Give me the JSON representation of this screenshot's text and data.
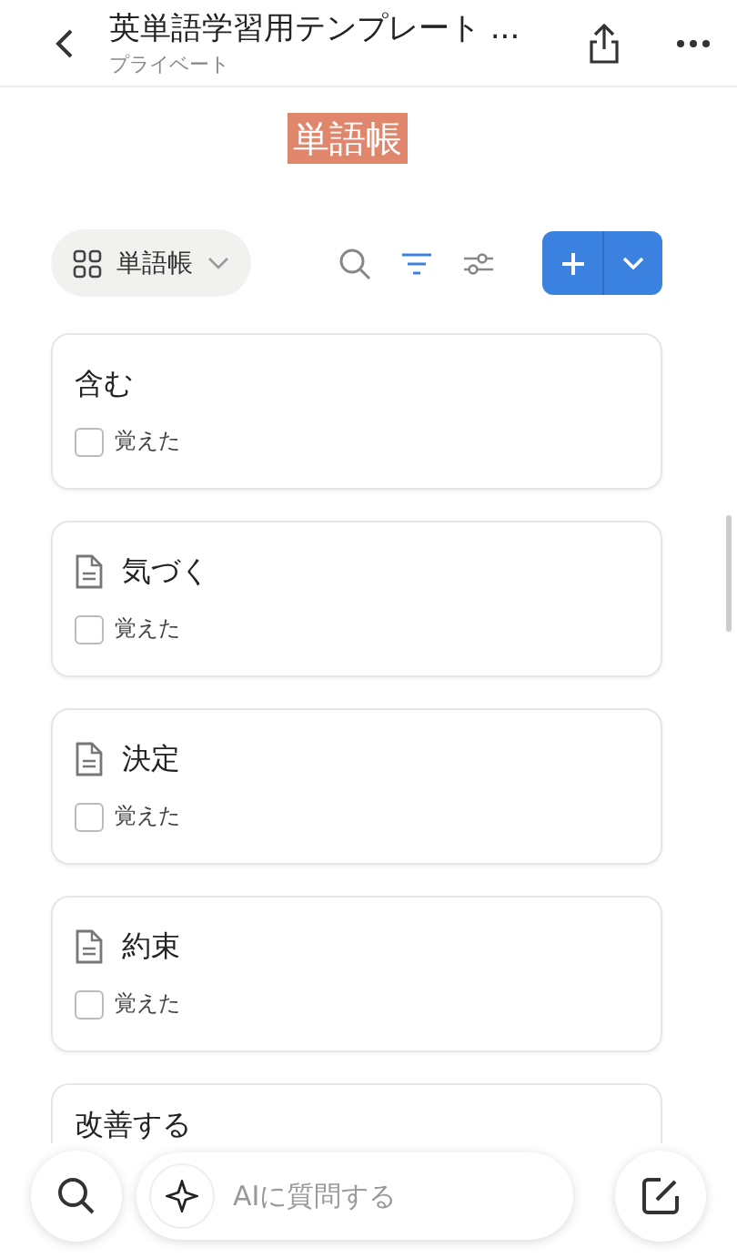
{
  "header": {
    "title": "英単語学習用テンプレート ...",
    "subtitle": "プライベート"
  },
  "page_title": "単語帳",
  "toolbar": {
    "view_label": "単語帳"
  },
  "cards": [
    {
      "kind": "plain",
      "title": "含む",
      "property": {
        "label": "覚えた",
        "checked": false
      }
    },
    {
      "kind": "page",
      "title": "気づく",
      "property": {
        "label": "覚えた",
        "checked": false
      }
    },
    {
      "kind": "page",
      "title": "決定",
      "property": {
        "label": "覚えた",
        "checked": false
      }
    },
    {
      "kind": "page",
      "title": "約束",
      "property": {
        "label": "覚えた",
        "checked": false
      }
    },
    {
      "kind": "plain",
      "title": "改善する"
    }
  ],
  "ai_bar": {
    "placeholder": "AIに質問する"
  }
}
